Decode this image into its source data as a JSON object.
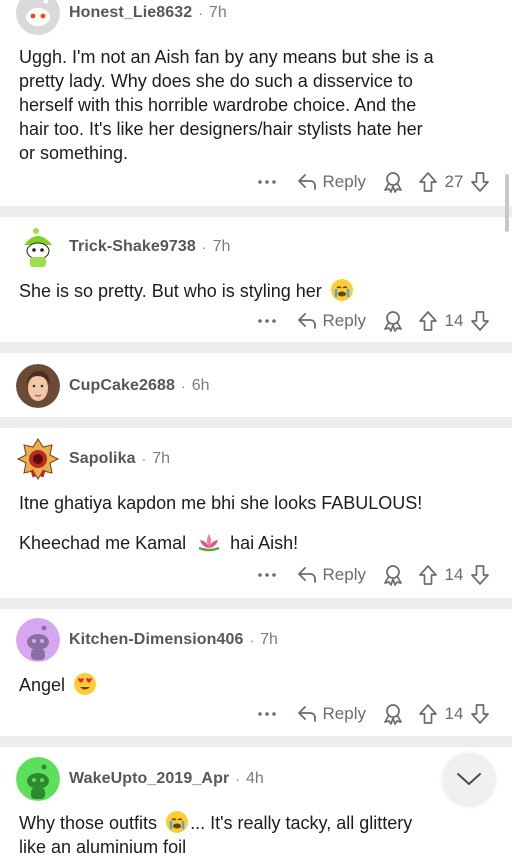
{
  "comments": [
    {
      "username": "Honest_Lie8632",
      "age": "7h",
      "lines": [
        "Uggh. I'm not an Aish fan by any means but she is a",
        "pretty lady. Why does she do such a disservice to",
        "herself with this horrible wardrobe choice. And the",
        "hair too. It's like her designers/hair stylists hate her",
        "or something."
      ],
      "reply_label": "Reply",
      "votes": "27",
      "avatar_icon": "snoo-avatar-icon"
    },
    {
      "username": "Trick-Shake9738",
      "age": "7h",
      "text": "She is so pretty. But who is styling her",
      "emoji": "crying-face-emoji",
      "reply_label": "Reply",
      "votes": "14",
      "avatar_icon": "green-snoo-avatar-icon"
    },
    {
      "username": "CupCake2688",
      "age": "6h",
      "avatar_icon": "photo-avatar-icon"
    },
    {
      "username": "Sapolika",
      "age": "7h",
      "line1": "Itne ghatiya kapdon me bhi she looks FABULOUS!",
      "line2_a": "Kheechad me Kamal",
      "line2_emoji": "lotus-emoji",
      "line2_b": "hai Aish!",
      "reply_label": "Reply",
      "votes": "14",
      "avatar_icon": "monster-avatar-icon"
    },
    {
      "username": "Kitchen-Dimension406",
      "age": "7h",
      "text": "Angel",
      "emoji": "heart-eyes-emoji",
      "reply_label": "Reply",
      "votes": "14",
      "avatar_icon": "purple-snoo-avatar-icon"
    },
    {
      "username": "WakeUpto_2019_Apr",
      "age": "4h",
      "line1_a": "Why those outfits",
      "line1_emoji": "crying-face-emoji",
      "line1_b": "... It's really tacky, all glittery",
      "line2": "like an aluminium foil",
      "avatar_icon": "green-snoo-avatar-icon"
    }
  ],
  "separator": "·",
  "colors": {
    "separator_bg": "#ecedef",
    "meta_text": "#7c7c7c",
    "action_icon": "#6b6c6f"
  },
  "scroll_button_icon": "chevron-down-icon"
}
